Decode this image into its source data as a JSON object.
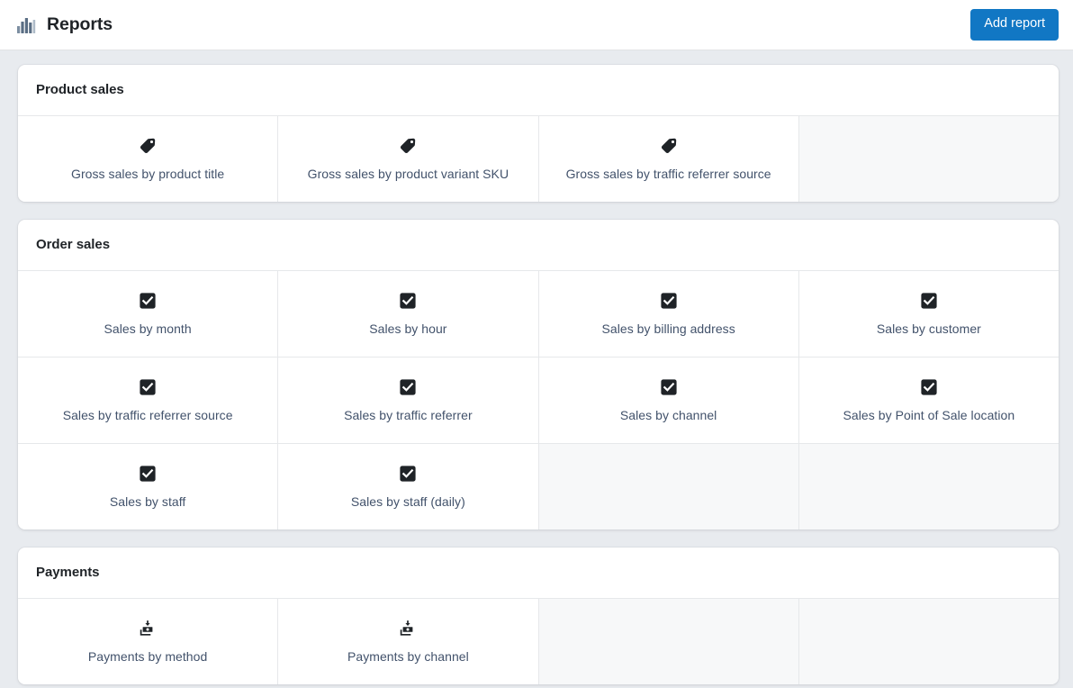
{
  "header": {
    "icon": "bar-chart-icon",
    "title": "Reports",
    "add_report_label": "Add report",
    "accent_color": "#1177c4"
  },
  "colors": {
    "page_background": "#e8ebef",
    "card_background": "#ffffff",
    "filler_cell": "#f7f8f9",
    "divider": "#e6e8ea",
    "label_text": "#42526b",
    "title_text": "#1f2327",
    "icon_dark": "#202223",
    "icon_slate": "#7c8ea1"
  },
  "sections": [
    {
      "title": "Product sales",
      "columns": 4,
      "tiles": [
        {
          "icon": "tag-icon",
          "label": "Gross sales by product title"
        },
        {
          "icon": "tag-icon",
          "label": "Gross sales by product variant SKU"
        },
        {
          "icon": "tag-icon",
          "label": "Gross sales by traffic referrer source"
        }
      ],
      "filler_cells": 1
    },
    {
      "title": "Order sales",
      "columns": 4,
      "tiles": [
        {
          "icon": "checkbox-checked-icon",
          "label": "Sales by month"
        },
        {
          "icon": "checkbox-checked-icon",
          "label": "Sales by hour"
        },
        {
          "icon": "checkbox-checked-icon",
          "label": "Sales by billing address"
        },
        {
          "icon": "checkbox-checked-icon",
          "label": "Sales by customer"
        },
        {
          "icon": "checkbox-checked-icon",
          "label": "Sales by traffic referrer source"
        },
        {
          "icon": "checkbox-checked-icon",
          "label": "Sales by traffic referrer"
        },
        {
          "icon": "checkbox-checked-icon",
          "label": "Sales by channel"
        },
        {
          "icon": "checkbox-checked-icon",
          "label": "Sales by Point of Sale location"
        },
        {
          "icon": "checkbox-checked-icon",
          "label": "Sales by staff"
        },
        {
          "icon": "checkbox-checked-icon",
          "label": "Sales by staff (daily)"
        }
      ],
      "filler_cells": 2
    },
    {
      "title": "Payments",
      "columns": 4,
      "tiles": [
        {
          "icon": "cash-deposit-icon",
          "label": "Payments by method"
        },
        {
          "icon": "cash-deposit-icon",
          "label": "Payments by channel"
        }
      ],
      "filler_cells": 2
    }
  ]
}
